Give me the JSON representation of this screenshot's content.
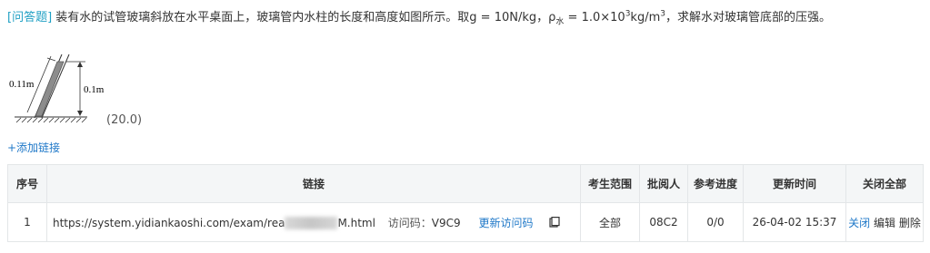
{
  "question": {
    "tag": "[问答题]",
    "text_part1": " 装有水的试管玻璃斜放在水平桌面上，玻璃管内水柱的长度和高度如图所示。取g = 10N/kg，ρ",
    "rho_sub": "水",
    "text_part2": " = 1.0×10",
    "exp": "3",
    "text_part3": "kg/m",
    "exp2": "3",
    "text_part4": "，求解水对玻璃管底部的压强。",
    "figure_label_length": "0.11m",
    "figure_label_height": "0.1m",
    "score": "(20.0)"
  },
  "add_link_label": "+添加链接",
  "table": {
    "headers": {
      "index": "序号",
      "link": "链接",
      "scope": "考生范围",
      "reviewer": "批阅人",
      "progress": "参考进度",
      "updated": "更新时间",
      "close_all": "关闭全部"
    },
    "rows": [
      {
        "index": "1",
        "url_start": "https://system.yidiankaoshi.com/exam/rea",
        "url_end": "M.html",
        "access_label": "访问码：",
        "access_code": "V9C9",
        "refresh_label": "更新访问码",
        "scope": "全部",
        "reviewer": "08C2",
        "progress": "0/0",
        "updated": "26-04-02 15:37",
        "action_close": "关闭",
        "action_edit": "编辑",
        "action_delete": "删除"
      }
    ]
  }
}
